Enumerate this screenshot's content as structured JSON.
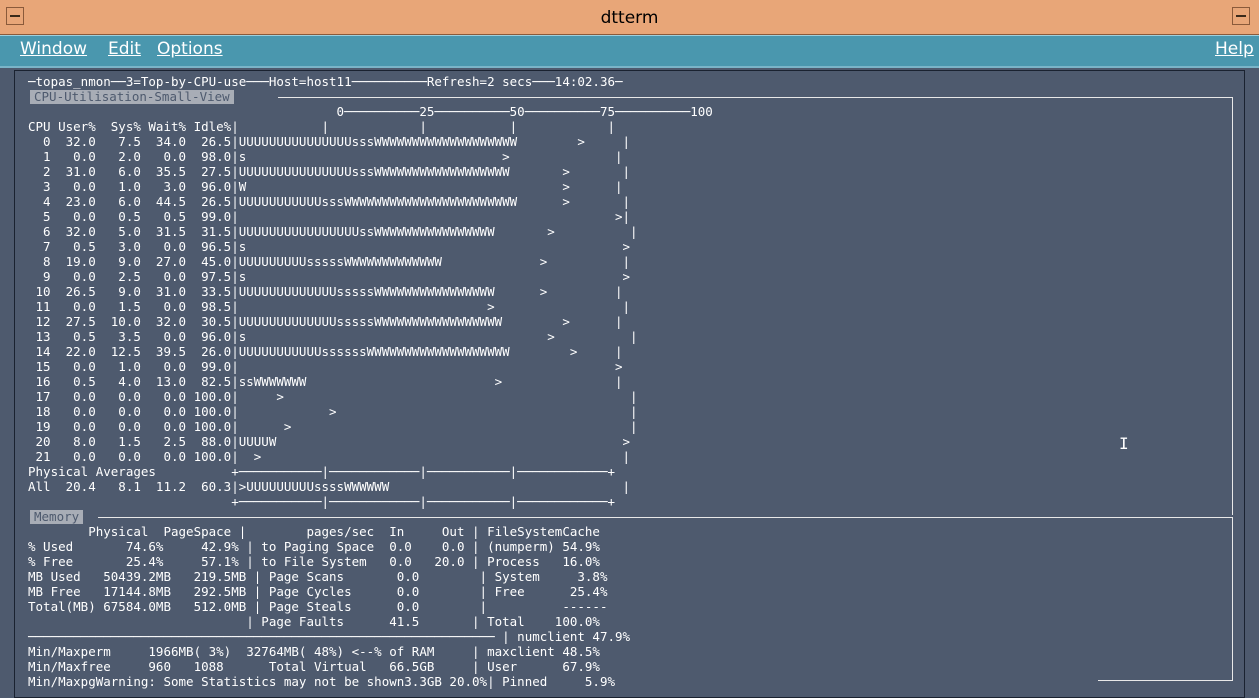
{
  "window": {
    "title": "dtterm"
  },
  "menubar": {
    "items": [
      "Window",
      "Edit",
      "Options"
    ],
    "help": "Help"
  },
  "sections": {
    "cpu": "CPU-Utilisation-Small-View",
    "memory": "Memory"
  },
  "terminal": {
    "screen": "─topas_nmon──3=Top-by-CPU-use───Host=host11──────────Refresh=2 secs───14:02.36─\n\n                                         0──────────25──────────50──────────75──────────100\nCPU User%  Sys% Wait% Idle%|           |            |           |            |\n  0  32.0   7.5  34.0  26.5|UUUUUUUUUUUUUUUsssWWWWWWWWWWWWWWWWWWW        >     |\n  1   0.0   2.0   0.0  98.0|s                                  >              |\n  2  31.0   6.0  35.5  27.5|UUUUUUUUUUUUUUUsssWWWWWWWWWWWWWWWWWW       >       |\n  3   0.0   1.0   3.0  96.0|W                                          >      |\n  4  23.0   6.0  44.5  26.5|UUUUUUUUUUUsssWWWWWWWWWWWWWWWWWWWWWWW      >       |\n  5   0.0   0.5   0.5  99.0|                                                  >|\n  6  32.0   5.0  31.5  31.5|UUUUUUUUUUUUUUUUssWWWWWWWWWWWWWWWW       >          |\n  7   0.5   3.0   0.0  96.5|s                                                  >\n  8  19.0   9.0  27.0  45.0|UUUUUUUUUsssssWWWWWWWWWWWWW             >          |\n  9   0.0   2.5   0.0  97.5|s                                                  >\n 10  26.5   9.0  31.0  33.5|UUUUUUUUUUUUUsssssWWWWWWWWWWWWWWWW      >         |\n 11   0.0   1.5   0.0  98.5|                                 >                 |\n 12  27.5  10.0  32.0  30.5|UUUUUUUUUUUUUsssssWWWWWWWWWWWWWWWWW        >      |\n 13   0.5   3.5   0.0  96.0|s                                        >          |\n 14  22.0  12.5  39.5  26.0|UUUUUUUUUUUssssssWWWWWWWWWWWWWWWWWWW        >     |\n 15   0.0   1.0   0.0  99.0|                                                  >\n 16   0.5   4.0  13.0  82.5|ssWWWWWWW                         >               |\n 17   0.0   0.0   0.0 100.0|     >                                              |\n 18   0.0   0.0   0.0 100.0|            >                                       |\n 19   0.0   0.0   0.0 100.0|      >                                             |\n 20   8.0   1.5   2.5  88.0|UUUUW                                              >\n 21   0.0   0.0   0.0 100.0|  >                                                |\nPhysical Averages          +───────────|────────────|───────────|────────────+\nAll  20.4   8.1  11.2  60.3|>UUUUUUUUUssssWWWWWW                               |\n                           +───────────|────────────|───────────|────────────+\n\n        Physical  PageSpace |        pages/sec  In     Out | FileSystemCache\n% Used       74.6%     42.9% | to Paging Space  0.0    0.0 | (numperm) 54.9%\n% Free       25.4%     57.1% | to File System   0.0   20.0 | Process   16.0%\nMB Used   50439.2MB   219.5MB | Page Scans       0.0        | System     3.8%\nMB Free   17144.8MB   292.5MB | Page Cycles      0.0        | Free      25.4%\nTotal(MB) 67584.0MB   512.0MB | Page Steals      0.0        |          ------\n                             | Page Faults      41.5       | Total    100.0%\n────────────────────────────────────────────────────────────── | numclient 47.9%\nMin/Maxperm     1966MB( 3%)  32764MB( 48%) <--% of RAM     | maxclient 48.5%\nMin/Maxfree     960   1088      Total Virtual   66.5GB     | User      67.9%\nMin/MaxpgWarning: Some Statistics may not be shown3.3GB 20.0%| Pinned     5.9%"
  }
}
